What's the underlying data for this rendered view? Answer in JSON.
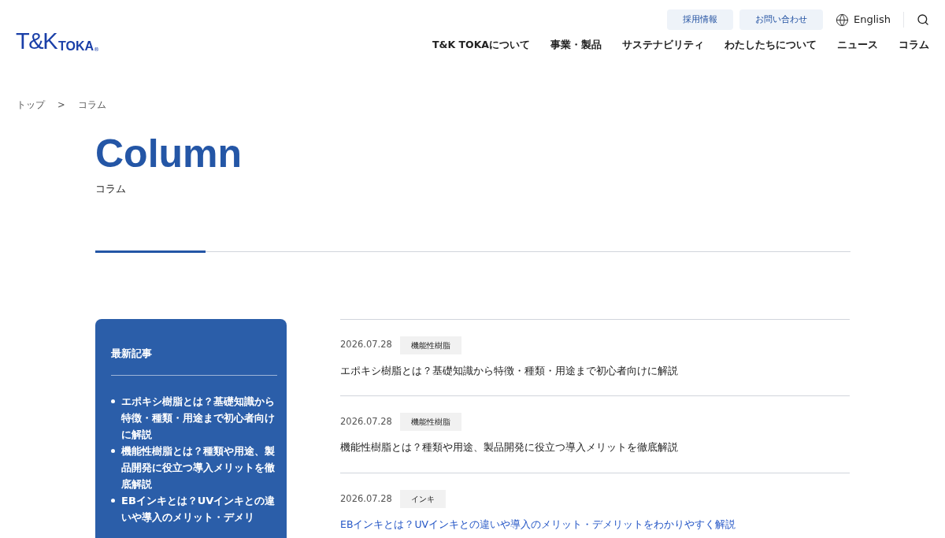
{
  "header": {
    "logo": {
      "main": "T&K",
      "sub": "TOKA",
      "mark": "®"
    },
    "utility": [
      {
        "label": "採用情報"
      },
      {
        "label": "お問い合わせ"
      }
    ],
    "language": "English",
    "nav": [
      "T&K TOKAについて",
      "事業・製品",
      "サステナビリティ",
      "わたしたちについて",
      "ニュース",
      "コラム"
    ]
  },
  "breadcrumb": [
    "トップ",
    ">",
    "コラム"
  ],
  "page_title": {
    "title": "Column",
    "subtitle": "コラム"
  },
  "sidebar": {
    "title": "最新記事",
    "items": [
      "エポキシ樹脂とは？基礎知識から特徴・種類・用途まで初心者向けに解説",
      "機能性樹脂とは？種類や用途、製品開発に役立つ導入メリットを徹底解説",
      "EBインキとは？UVインキとの違いや導入のメリット・デメリ"
    ]
  },
  "articles": [
    {
      "date": "2026.07.28",
      "tag": "機能性樹脂",
      "title": "エポキシ樹脂とは？基礎知識から特徴・種類・用途まで初心者向けに解説",
      "hovered": false
    },
    {
      "date": "2026.07.28",
      "tag": "機能性樹脂",
      "title": "機能性樹脂とは？種類や用途、製品開発に役立つ導入メリットを徹底解説",
      "hovered": false
    },
    {
      "date": "2026.07.28",
      "tag": "インキ",
      "title": "EBインキとは？UVインキとの違いや導入のメリット・デメリットをわかりやすく解説",
      "hovered": true
    }
  ]
}
